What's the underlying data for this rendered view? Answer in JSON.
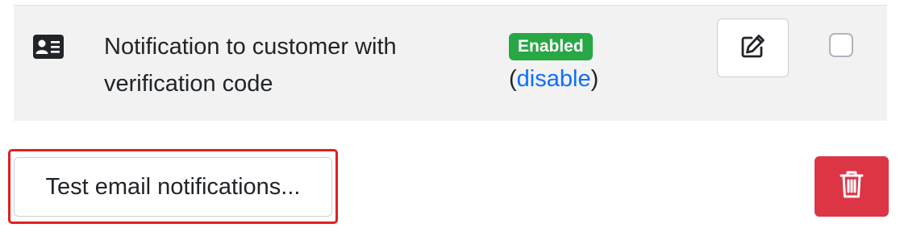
{
  "notification_row": {
    "type_icon": "person-card-icon",
    "title": "Notification to customer with verification code",
    "status_badge": "Enabled",
    "status_color": "#28a745",
    "disable_open": "(",
    "disable_link": "disable",
    "disable_close": ")",
    "edit_icon": "pencil-square-icon",
    "selected": false
  },
  "actions": {
    "test_button_label": "Test email notifications...",
    "delete_icon": "trash-icon",
    "delete_color": "#dc3545"
  }
}
